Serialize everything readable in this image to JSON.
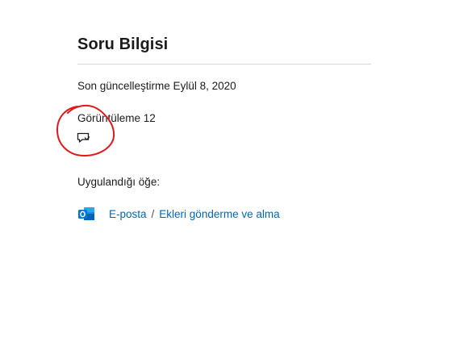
{
  "question_info": {
    "title": "Soru Bilgisi",
    "last_updated": "Son güncelleştirme Eylül 8, 2020",
    "views": "Görüntüleme 12",
    "feedback_icon": "chat-bubble-icon",
    "annotation_color": "#e0191c"
  },
  "applies_to": {
    "label": "Uygulandığı öğe:",
    "product_icon": "outlook-icon",
    "breadcrumb": {
      "item1": "E-posta",
      "separator": "/",
      "item2": "Ekleri gönderme ve alma"
    },
    "link_color": "#0067b8"
  }
}
